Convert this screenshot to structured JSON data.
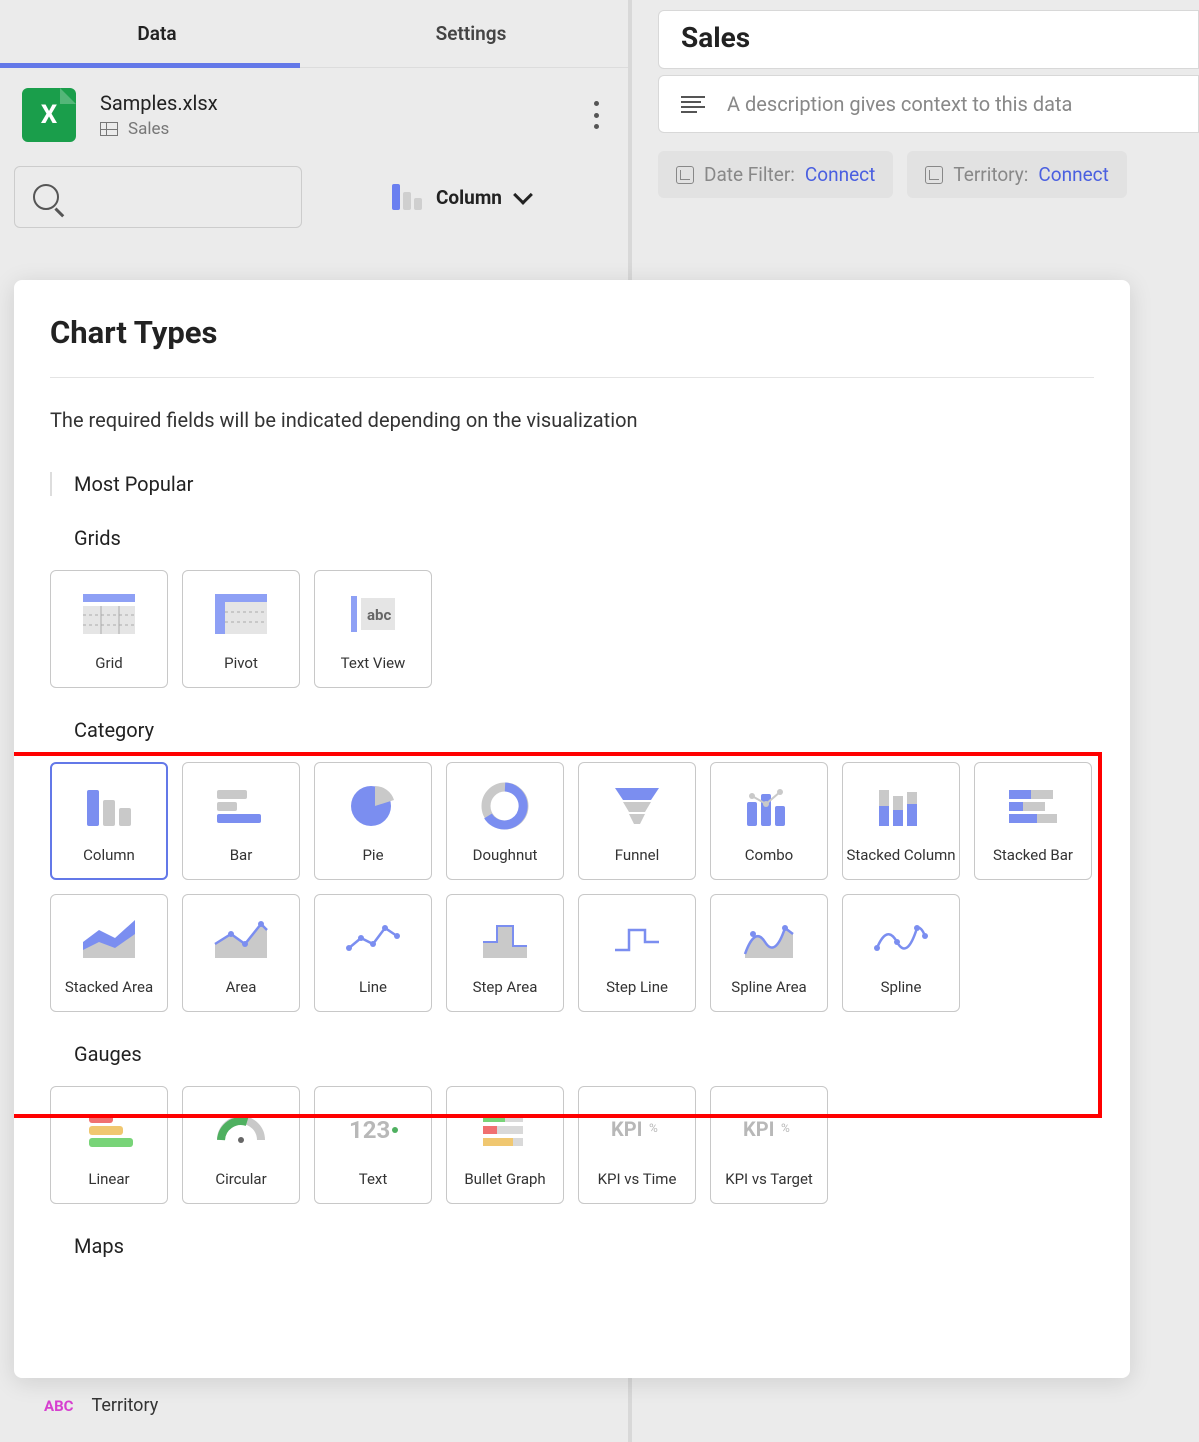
{
  "tabs": {
    "data": "Data",
    "settings": "Settings"
  },
  "file": {
    "name": "Samples.xlsx",
    "sheet": "Sales"
  },
  "chart_chip": {
    "label": "Column"
  },
  "right": {
    "title": "Sales",
    "desc_placeholder": "A description gives context to this data",
    "filters": {
      "date": {
        "label": "Date Filter:",
        "action": "Connect"
      },
      "territory": {
        "label": "Territory:",
        "action": "Connect"
      }
    }
  },
  "popover": {
    "title": "Chart Types",
    "hint": "The required fields will be indicated depending on the visualization",
    "sections": {
      "popular": "Most Popular",
      "grids": "Grids",
      "category": "Category",
      "gauges": "Gauges",
      "maps": "Maps"
    },
    "grids": {
      "grid": "Grid",
      "pivot": "Pivot",
      "textview": "Text View"
    },
    "category": {
      "column": "Column",
      "bar": "Bar",
      "pie": "Pie",
      "doughnut": "Doughnut",
      "funnel": "Funnel",
      "combo": "Combo",
      "stacked_column": "Stacked Column",
      "stacked_bar": "Stacked Bar",
      "stacked_area": "Stacked Area",
      "area": "Area",
      "line": "Line",
      "step_area": "Step Area",
      "step_line": "Step Line",
      "spline_area": "Spline Area",
      "spline": "Spline"
    },
    "gauges": {
      "linear": "Linear",
      "circular": "Circular",
      "text": "Text",
      "bullet": "Bullet Graph",
      "kpi_time": "KPI vs Time",
      "kpi_target": "KPI vs Target"
    }
  },
  "footer_field": {
    "type": "ABC",
    "name": "Territory"
  }
}
